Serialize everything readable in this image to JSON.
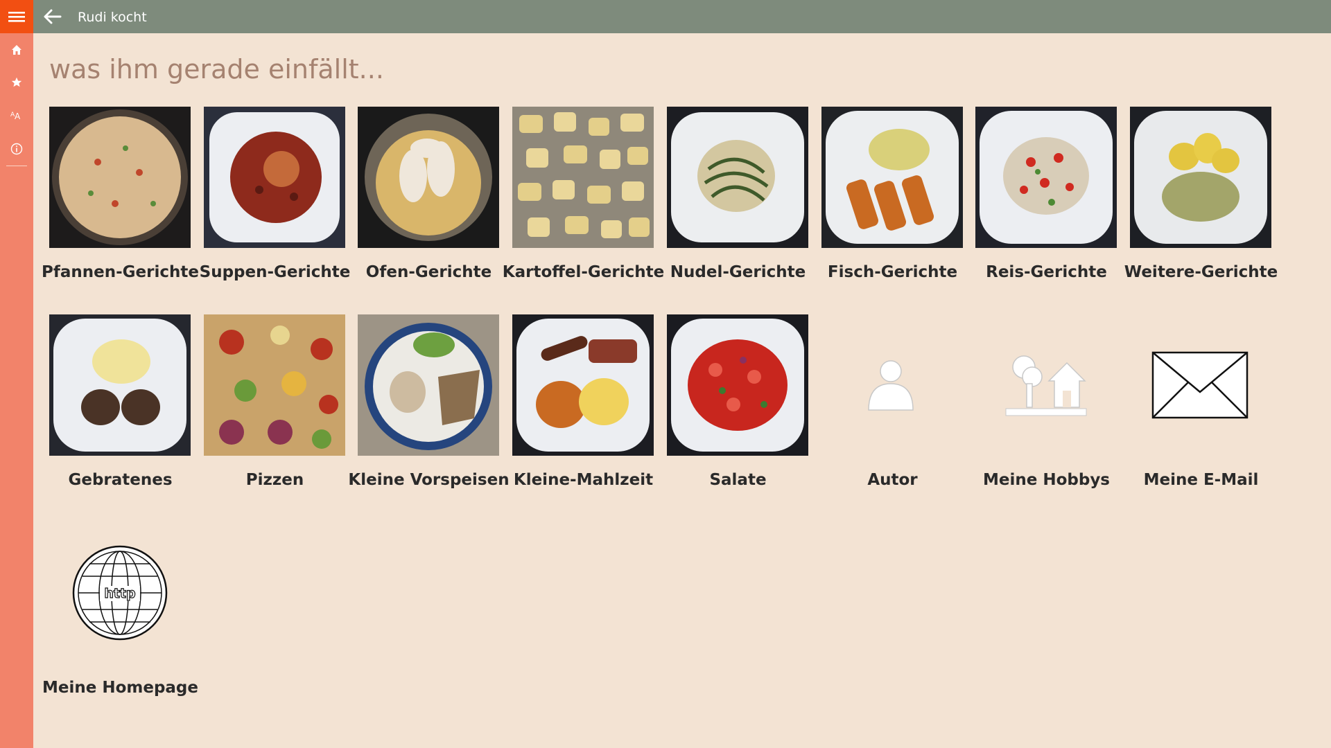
{
  "app": {
    "title": "Rudi kocht"
  },
  "titlebar": {
    "menu_icon": "hamburger-icon",
    "back_icon": "back-arrow-icon"
  },
  "sidebar": {
    "items": [
      {
        "icon": "home-icon"
      },
      {
        "icon": "star-icon"
      },
      {
        "icon": "font-size-icon"
      },
      {
        "icon": "info-icon"
      }
    ]
  },
  "page": {
    "heading": "was ihm gerade einfällt..."
  },
  "tiles": [
    {
      "label": "Pfannen-Gerichte",
      "image": "pan-dish-photo"
    },
    {
      "label": "Suppen-Gerichte",
      "image": "soup-photo"
    },
    {
      "label": "Ofen-Gerichte",
      "image": "oven-dish-photo"
    },
    {
      "label": "Kartoffel-Gerichte",
      "image": "potatoes-photo"
    },
    {
      "label": "Nudel-Gerichte",
      "image": "pasta-photo"
    },
    {
      "label": "Fisch-Gerichte",
      "image": "fish-photo"
    },
    {
      "label": "Reis-Gerichte",
      "image": "rice-photo"
    },
    {
      "label": "Weitere-Gerichte",
      "image": "other-dishes-photo"
    },
    {
      "label": "Gebratenes",
      "image": "fried-photo"
    },
    {
      "label": "Pizzen",
      "image": "pizza-photo"
    },
    {
      "label": "Kleine Vorspeisen",
      "image": "starter-photo"
    },
    {
      "label": "Kleine-Mahlzeit",
      "image": "small-meal-photo"
    },
    {
      "label": "Salate",
      "image": "salad-photo"
    },
    {
      "label": "Autor",
      "image": "person-icon"
    },
    {
      "label": "Meine Hobbys",
      "image": "tree-house-icon"
    },
    {
      "label": "Meine E-Mail",
      "image": "envelope-icon"
    },
    {
      "label": "Meine Homepage",
      "image": "globe-http-icon"
    }
  ],
  "colors": {
    "background": "#f3e3d3",
    "titlebar": "#7e8b7c",
    "sidebar": "#f2836a",
    "menu_button": "#f24f12",
    "heading": "#a58270"
  }
}
